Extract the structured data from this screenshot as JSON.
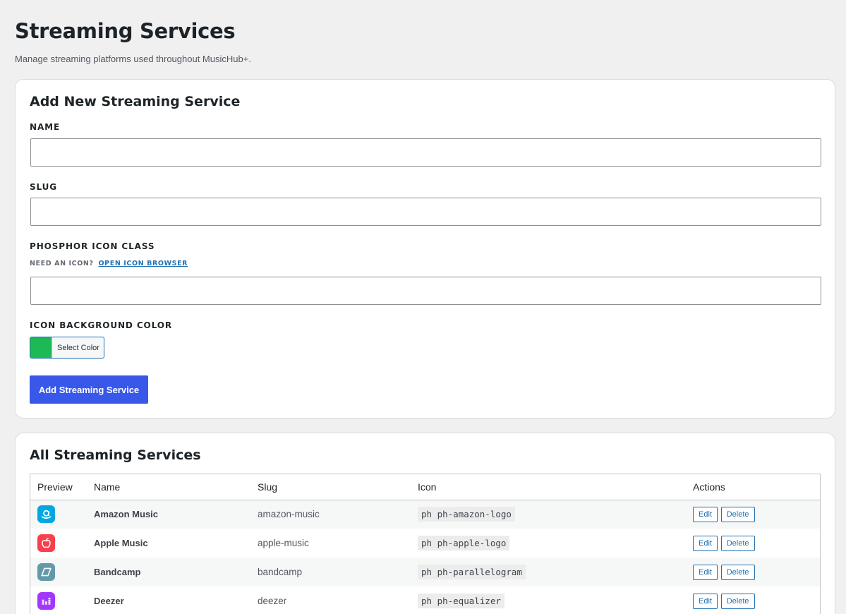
{
  "page": {
    "title": "Streaming Services",
    "description": "Manage streaming platforms used throughout MusicHub+."
  },
  "add_form": {
    "heading": "Add New Streaming Service",
    "name_label": "NAME",
    "name_value": "",
    "slug_label": "SLUG",
    "slug_value": "",
    "icon_label": "PHOSPHOR ICON CLASS",
    "icon_hint": "NEED AN ICON?",
    "icon_hint_link": "OPEN ICON BROWSER",
    "icon_value": "",
    "color_label": "ICON BACKGROUND COLOR",
    "color_button": "Select Color",
    "color_value": "#1db954",
    "submit": "Add Streaming Service"
  },
  "list": {
    "heading": "All Streaming Services",
    "columns": [
      "Preview",
      "Name",
      "Slug",
      "Icon",
      "Actions"
    ],
    "edit_label": "Edit",
    "delete_label": "Delete",
    "rows": [
      {
        "name": "Amazon Music",
        "slug": "amazon-music",
        "icon": "ph ph-amazon-logo",
        "color": "#00a8e1",
        "icon_name": "amazon-logo-icon"
      },
      {
        "name": "Apple Music",
        "slug": "apple-music",
        "icon": "ph ph-apple-logo",
        "color": "#fa3e4b",
        "icon_name": "apple-logo-icon"
      },
      {
        "name": "Bandcamp",
        "slug": "bandcamp",
        "icon": "ph ph-parallelogram",
        "color": "#629aa9",
        "icon_name": "parallelogram-icon"
      },
      {
        "name": "Deezer",
        "slug": "deezer",
        "icon": "ph ph-equalizer",
        "color": "#a238ff",
        "icon_name": "equalizer-icon"
      }
    ]
  }
}
